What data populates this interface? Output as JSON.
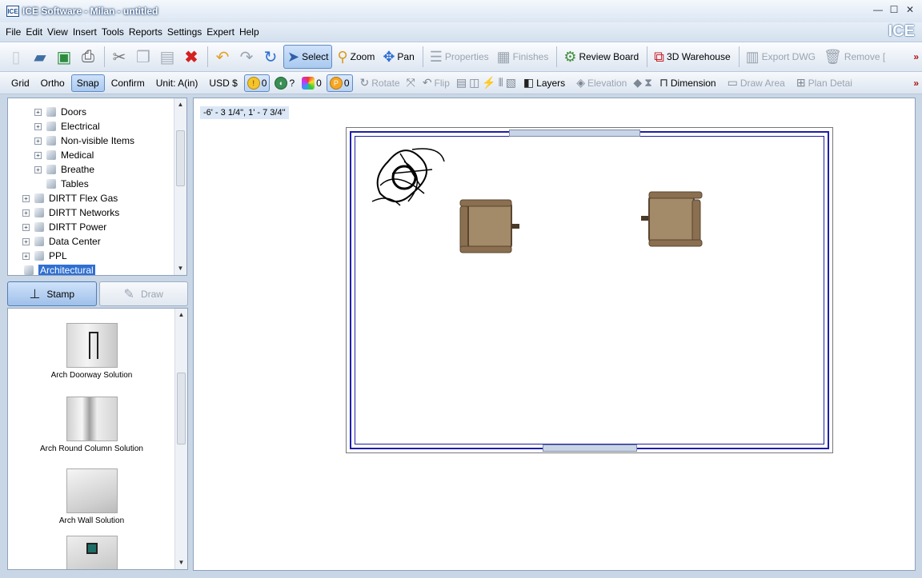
{
  "window": {
    "app_icon": "ICE",
    "title": "ICE Software - Milan - untitled",
    "brand": "ICE",
    "controls": [
      "—",
      "☐",
      "✕"
    ]
  },
  "menu": [
    "File",
    "Edit",
    "View",
    "Insert",
    "Tools",
    "Reports",
    "Settings",
    "Expert",
    "Help"
  ],
  "toolbar1": {
    "select": "Select",
    "zoom": "Zoom",
    "pan": "Pan",
    "properties": "Properties",
    "finishes": "Finishes",
    "review_board": "Review Board",
    "warehouse": "3D Warehouse",
    "export_dwg": "Export DWG",
    "remove": "Remove [",
    "more": "»"
  },
  "toolbar2": {
    "grid": "Grid",
    "ortho": "Ortho",
    "snap": "Snap",
    "confirm": "Confirm",
    "unit": "Unit: A(in)",
    "currency": "USD $",
    "badge1_count": "0",
    "badge2_count": "?",
    "badge3_count": "0",
    "badge4_count": "0",
    "rotate": "Rotate",
    "flip": "Flip",
    "layers": "Layers",
    "elevation": "Elevation",
    "dimension": "Dimension",
    "draw_area": "Draw Area",
    "plan_detail": "Plan Detai",
    "more": "»"
  },
  "tree": [
    {
      "label": "Doors",
      "indent": 2,
      "expander": true
    },
    {
      "label": "Electrical",
      "indent": 2,
      "expander": true
    },
    {
      "label": "Non-visible Items",
      "indent": 2,
      "expander": true
    },
    {
      "label": "Medical",
      "indent": 2,
      "expander": true
    },
    {
      "label": "Breathe",
      "indent": 2,
      "expander": true
    },
    {
      "label": "Tables",
      "indent": 2,
      "expander": false
    },
    {
      "label": "DIRTT Flex Gas",
      "indent": 1,
      "expander": true
    },
    {
      "label": "DIRTT Networks",
      "indent": 1,
      "expander": true
    },
    {
      "label": "DIRTT Power",
      "indent": 1,
      "expander": true
    },
    {
      "label": "Data Center",
      "indent": 1,
      "expander": true
    },
    {
      "label": "PPL",
      "indent": 1,
      "expander": true
    },
    {
      "label": "Architectural",
      "indent": 1,
      "expander": false,
      "selected": true
    }
  ],
  "modes": {
    "stamp": "Stamp",
    "draw": "Draw"
  },
  "library": [
    {
      "label": "Arch Doorway Solution"
    },
    {
      "label": "Arch Round Column Solution"
    },
    {
      "label": "Arch Wall Solution"
    }
  ],
  "canvas": {
    "coordinates": "-6' - 3 1/4\", 1' - 7 3/4\""
  },
  "colors": {
    "wall": "#1e1ea8",
    "selection": "#2f6fd2",
    "chair": "#a38a68"
  }
}
